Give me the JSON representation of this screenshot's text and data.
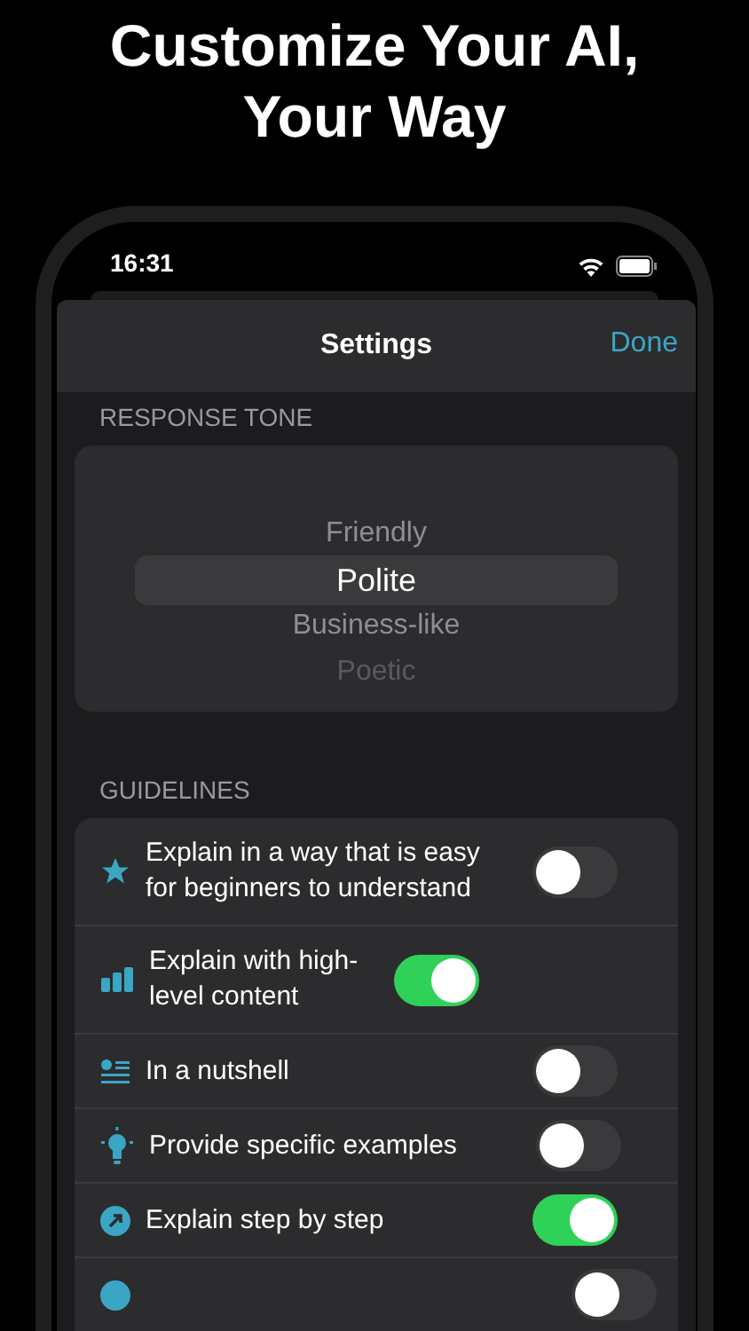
{
  "headline": [
    "Customize Your AI,",
    "Your Way"
  ],
  "status_bar": {
    "time": "16:31"
  },
  "sheet": {
    "title": "Settings",
    "done": "Done"
  },
  "response_tone": {
    "label": "RESPONSE TONE",
    "options": [
      {
        "label": "Friendly",
        "selected": false
      },
      {
        "label": "Polite",
        "selected": true
      },
      {
        "label": "Business-like",
        "selected": false
      },
      {
        "label": "Poetic",
        "selected": false
      }
    ]
  },
  "guidelines": {
    "label": "GUIDELINES",
    "items": [
      {
        "label": "Explain in a way that is easy for beginners to understand",
        "on": false
      },
      {
        "label": "Explain with high-level content",
        "on": true
      },
      {
        "label": "In a nutshell",
        "on": false
      },
      {
        "label": "Provide specific examples",
        "on": false
      },
      {
        "label": "Explain step by step",
        "on": true
      },
      {
        "on": false
      }
    ]
  }
}
